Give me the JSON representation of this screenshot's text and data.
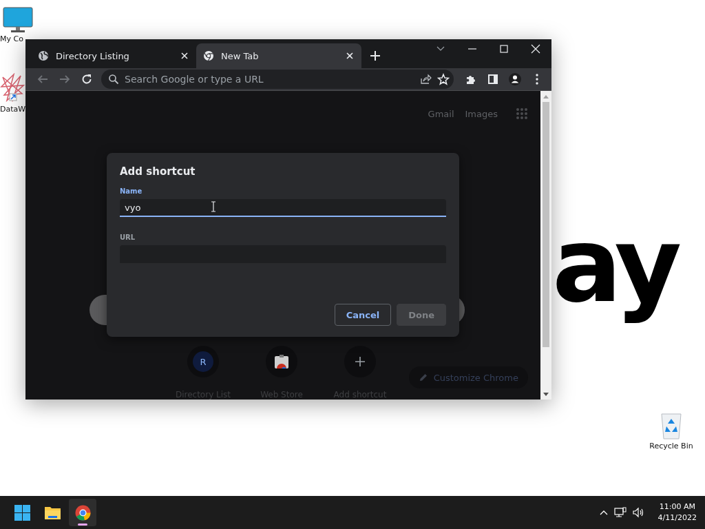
{
  "desktop": {
    "wallpaper_text": "ay",
    "icons": [
      {
        "kind": "monitor",
        "label": "My Co"
      },
      {
        "kind": "app",
        "label": "DataW"
      },
      {
        "kind": "recycle",
        "label": "Recycle Bin"
      }
    ]
  },
  "browser": {
    "tabs": [
      {
        "title": "Directory Listing",
        "kind": "globe",
        "selected": false
      },
      {
        "title": "New Tab",
        "kind": "chrome",
        "selected": true
      }
    ],
    "omnibox": {
      "placeholder": "Search Google or type a URL"
    },
    "header_links": [
      "Gmail",
      "Images"
    ],
    "shortcuts": [
      {
        "kind": "letter",
        "letter": "R",
        "label": "Directory List"
      },
      {
        "kind": "store",
        "label": "Web Store"
      },
      {
        "kind": "add",
        "label": "Add shortcut"
      }
    ],
    "customize_button": "Customize Chrome"
  },
  "dialog": {
    "title": "Add shortcut",
    "fields": [
      {
        "label": "Name",
        "value": "vyo",
        "focused": true
      },
      {
        "label": "URL",
        "focused": false
      }
    ],
    "buttons": [
      {
        "label": "Cancel",
        "disabled": false
      },
      {
        "label": "Done",
        "disabled": true
      }
    ]
  },
  "taskbar": {
    "apps": [
      {
        "kind": "start",
        "active": false
      },
      {
        "kind": "explorer",
        "active": false
      },
      {
        "kind": "chrome",
        "active": true
      }
    ],
    "clock": {
      "time": "11:00 AM",
      "date": "4/11/2022"
    }
  }
}
